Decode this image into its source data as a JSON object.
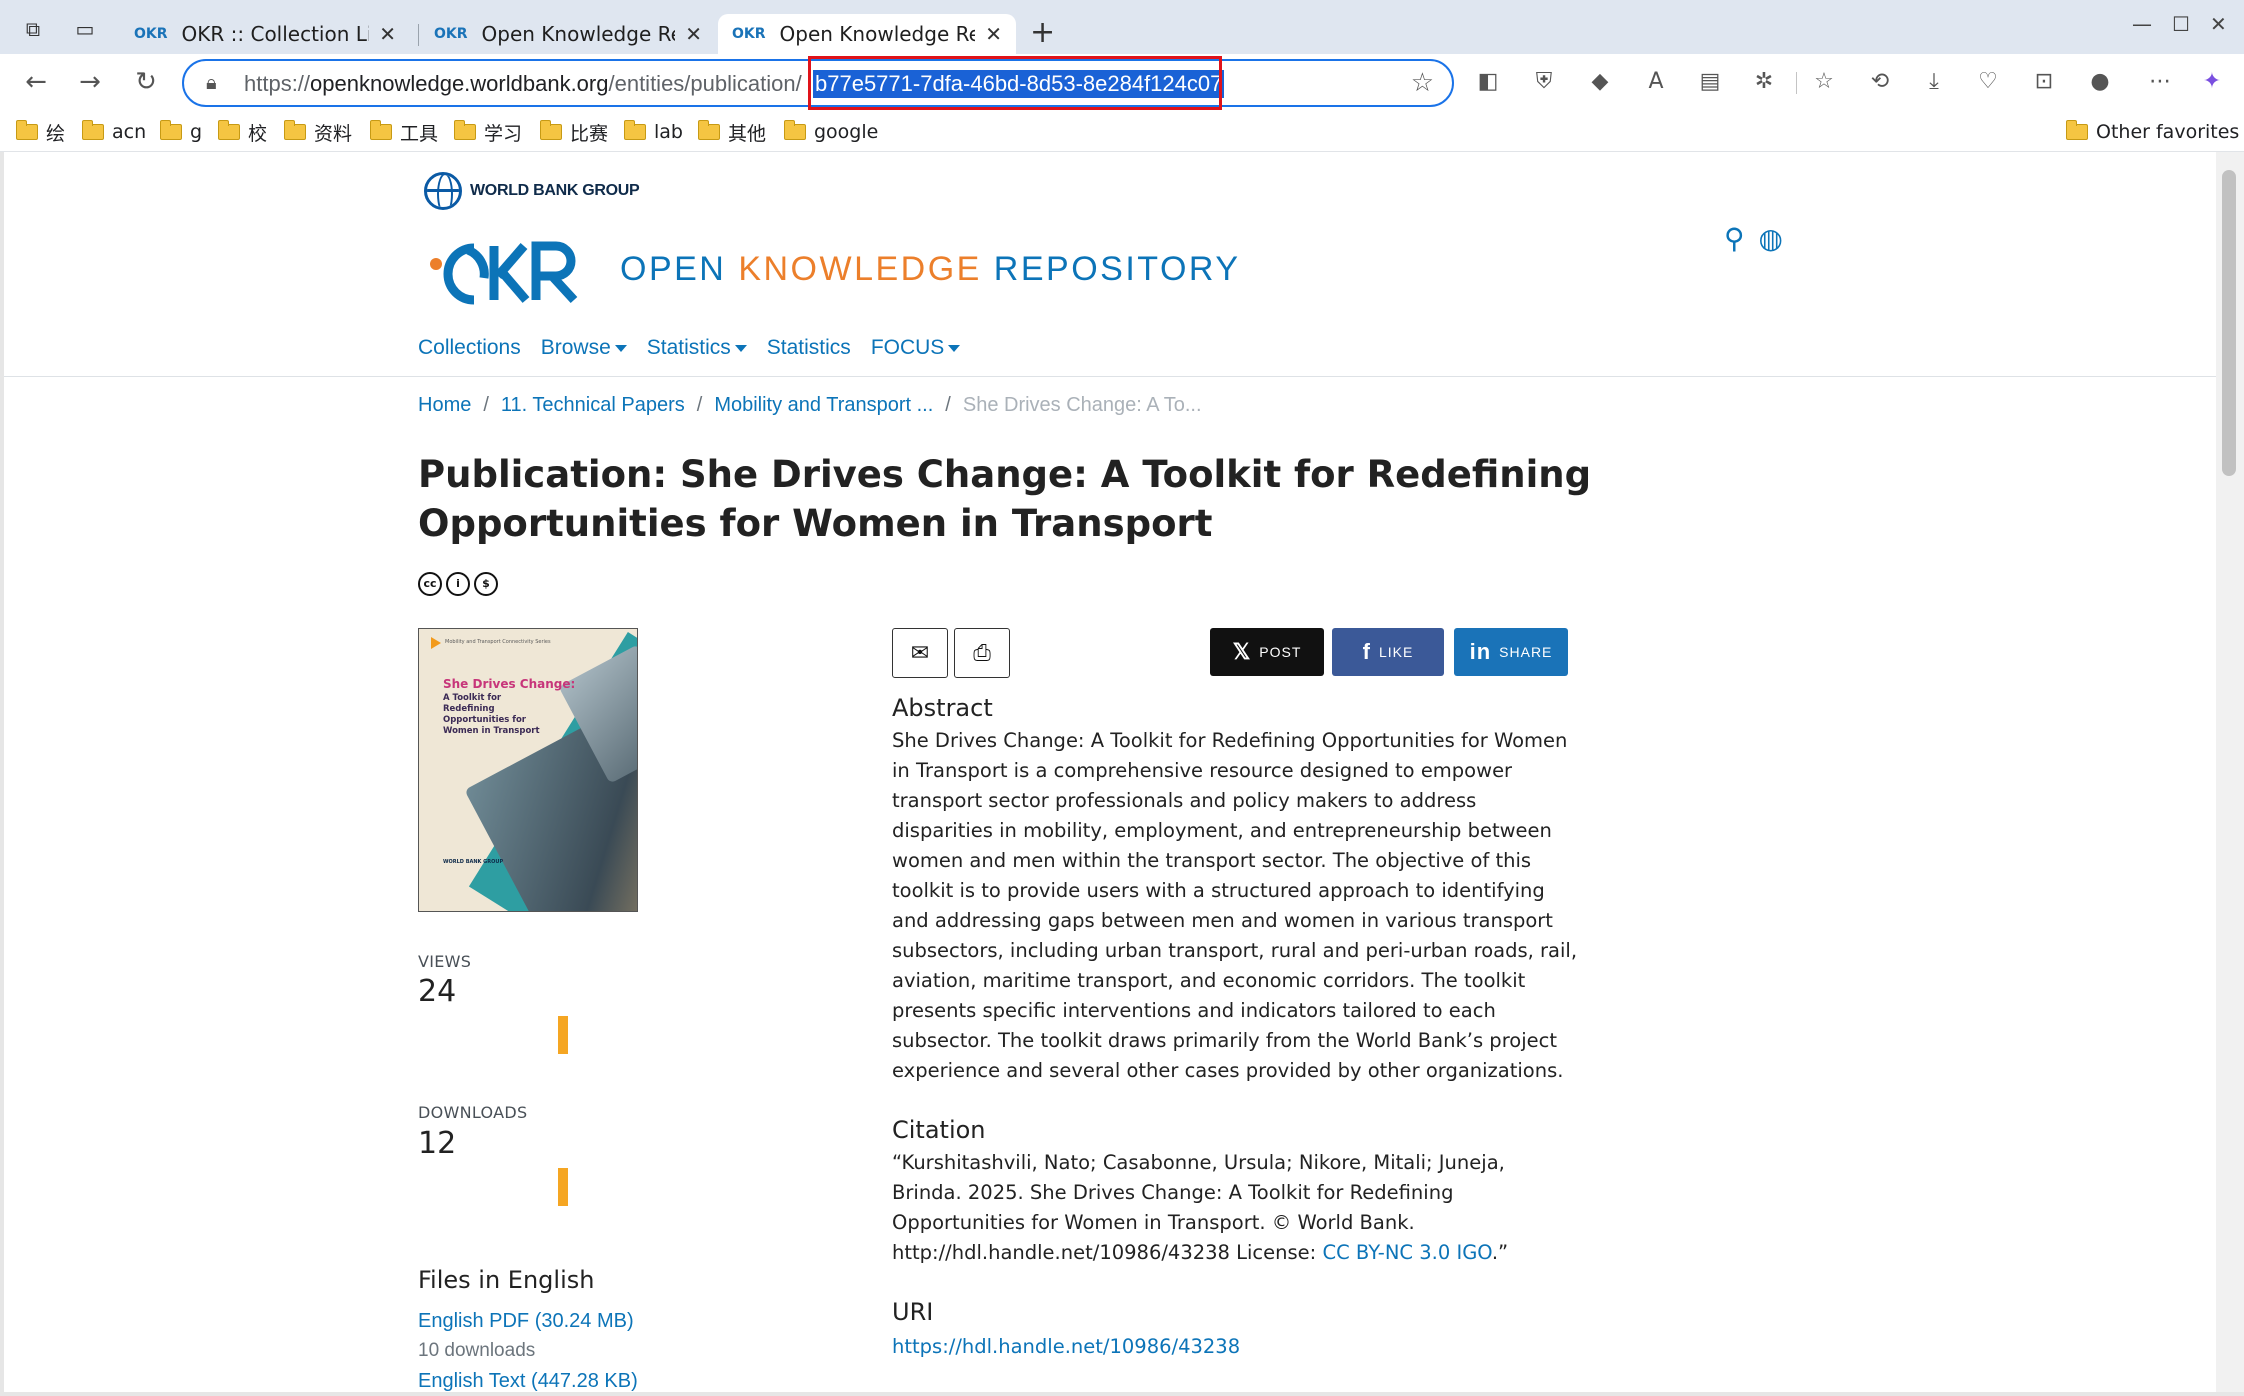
{
  "browser": {
    "tabs": [
      {
        "title": "OKR :: Collection List"
      },
      {
        "title": "Open Knowledge Reposito"
      },
      {
        "title": "Open Knowledge Reposito"
      }
    ],
    "url_prefix_host": "openknowledge.worldbank.org",
    "url_scheme": "https://",
    "url_path": "/entities/publication/",
    "url_selected": "b77e5771-7dfa-46bd-8d53-8e284f124c07",
    "bookmarks": [
      "绘",
      "acn",
      "g",
      "校",
      "资料",
      "工具",
      "学习",
      "比赛",
      "lab",
      "其他",
      "google"
    ],
    "other_favorites": "Other favorites"
  },
  "site": {
    "wbg_name": "WORLD BANK GROUP",
    "logo_text": "OKR",
    "name_part1": "OPEN ",
    "name_part2": "KNOWLEDGE",
    "name_part3": " REPOSITORY",
    "nav": {
      "collections": "Collections",
      "browse": "Browse",
      "statistics_menu": "Statistics",
      "statistics": "Statistics",
      "focus": "FOCUS"
    }
  },
  "breadcrumb": {
    "home": "Home",
    "level1": "11. Technical Papers",
    "level2": "Mobility and Transport ...",
    "current": "She Drives Change: A To..."
  },
  "publication": {
    "title": "Publication: She Drives Change: A Toolkit for Redefining Opportunities for Women in Transport",
    "cover": {
      "series": "Mobility and Transport Connectivity Series",
      "title1": "She Drives Change:",
      "title2": "A Toolkit for Redefining Opportunities for Women in Transport",
      "publisher": "WORLD BANK GROUP"
    },
    "views_label": "VIEWS",
    "views": "24",
    "downloads_label": "DOWNLOADS",
    "downloads": "12",
    "files_heading": "Files in English",
    "files": [
      {
        "link": "English PDF (30.24 MB)",
        "meta": "10 downloads"
      },
      {
        "link": "English Text (447.28 KB)"
      }
    ],
    "share": {
      "post": "POST",
      "like": "LIKE",
      "share": "SHARE"
    },
    "abstract_heading": "Abstract",
    "abstract": "She Drives Change: A Toolkit for Redefining Opportunities for Women in Transport is a comprehensive resource designed to empower transport sector professionals and policy makers to address disparities in mobility, employment, and entrepreneurship between women and men within the transport sector. The objective of this toolkit is to provide users with a structured approach to identifying and addressing gaps between men and women in various transport subsectors, including urban transport, rural and peri-urban roads, rail, aviation, maritime transport, and economic corridors. The toolkit presents specific interventions and indicators tailored to each subsector. The toolkit draws primarily from the World Bank’s project experience and several other cases provided by other organizations.",
    "citation_heading": "Citation",
    "citation": "“Kurshitashvili, Nato; Casabonne, Ursula; Nikore, Mitali; Juneja, Brinda. 2025. She Drives Change: A Toolkit for Redefining Opportunities for Women in Transport. © World Bank. http://hdl.handle.net/10986/43238 License: ",
    "citation_license": "CC BY-NC 3.0 IGO",
    "citation_end": ".”",
    "uri_heading": "URI",
    "uri": "https://hdl.handle.net/10986/43238"
  }
}
